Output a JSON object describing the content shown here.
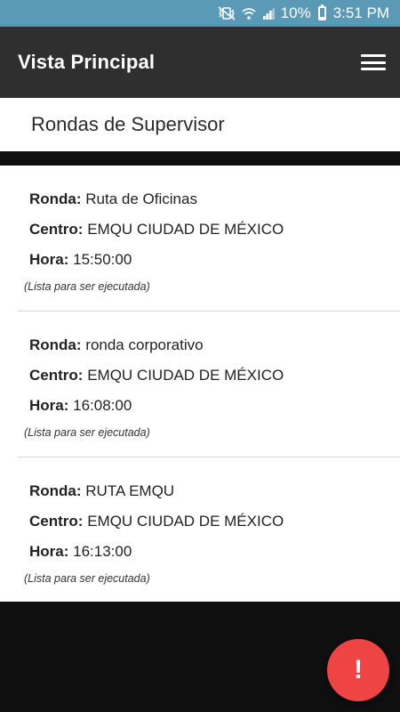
{
  "status_bar": {
    "battery": "10%",
    "time": "3:51 PM",
    "icons": [
      "mute-vibrate-icon",
      "wifi-icon",
      "signal-icon",
      "battery-icon"
    ]
  },
  "app_bar": {
    "title": "Vista Principal",
    "menu_icon": "hamburger-menu-icon"
  },
  "section": {
    "title": "Rondas de Supervisor"
  },
  "rondas": [
    {
      "ronda_label": "Ronda:",
      "ronda": "Ruta de Oficinas",
      "centro_label": "Centro:",
      "centro": "EMQU CIUDAD DE MÉXICO",
      "hora_label": "Hora:",
      "hora": "15:50:00",
      "note": "(Lista para ser ejecutada)"
    },
    {
      "ronda_label": "Ronda:",
      "ronda": "ronda corporativo",
      "centro_label": "Centro:",
      "centro": "EMQU CIUDAD DE MÉXICO",
      "hora_label": "Hora:",
      "hora": "16:08:00",
      "note": "(Lista para ser ejecutada)"
    },
    {
      "ronda_label": "Ronda:",
      "ronda": "RUTA EMQU",
      "centro_label": "Centro:",
      "centro": "EMQU CIUDAD DE MÉXICO",
      "hora_label": "Hora:",
      "hora": "16:13:00",
      "note": "(Lista para ser ejecutada)"
    }
  ],
  "fab": {
    "label": "!",
    "color": "#ef4444"
  },
  "colors": {
    "status_bar": "#5a9ab6",
    "app_bar": "#2f2f2f",
    "background": "#0f0f0f"
  }
}
